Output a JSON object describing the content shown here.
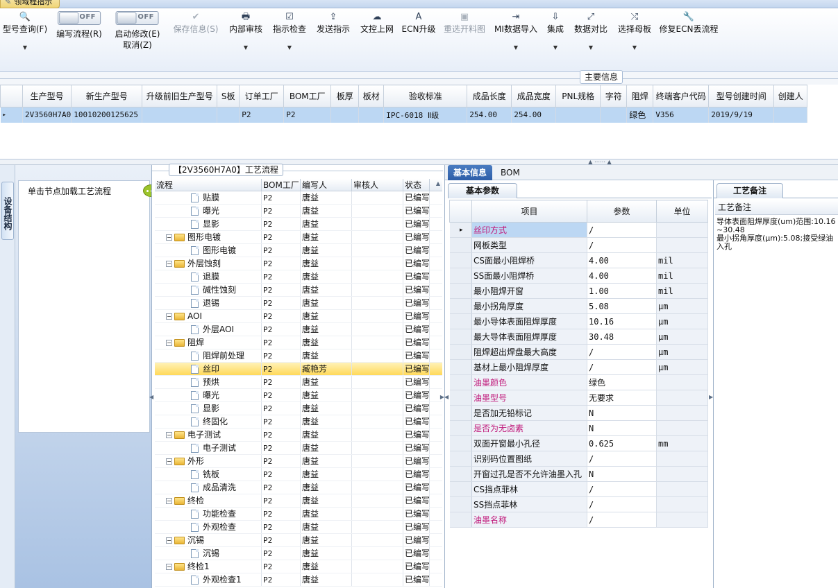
{
  "window": {
    "tab_label": "领域程指示"
  },
  "toolbar": [
    {
      "id": "model-query",
      "icon": "🔍",
      "label": "型号查询(F)",
      "dropdown": true,
      "disabled": false
    },
    {
      "id": "write-flow",
      "label": "编写流程(R)",
      "toggle": "OFF"
    },
    {
      "id": "start-modify",
      "label": "启动修改(E)",
      "label2": "取消(Z)",
      "toggle": "OFF"
    },
    {
      "id": "save-info",
      "icon": "✔",
      "label": "保存信息(S)",
      "disabled": true
    },
    {
      "id": "internal-review",
      "icon": "🖶",
      "label": "内部审核",
      "dropdown": true,
      "disabled": false
    },
    {
      "id": "instruction-check",
      "icon": "☑",
      "label": "指示检查",
      "dropdown": true,
      "disabled": false
    },
    {
      "id": "send-instruction",
      "icon": "⇪",
      "label": "发送指示",
      "disabled": false
    },
    {
      "id": "doc-upload",
      "icon": "☁",
      "label": "文控上网",
      "disabled": false
    },
    {
      "id": "ecn-upgrade",
      "icon": "A",
      "label": "ECN升级",
      "disabled": false
    },
    {
      "id": "reselect-cut",
      "icon": "▣",
      "label": "重选开料图",
      "disabled": true
    },
    {
      "id": "mi-import",
      "icon": "⇥",
      "label": "MI数据导入",
      "dropdown": true,
      "disabled": false
    },
    {
      "id": "integrate",
      "icon": "⇩",
      "label": "集成",
      "dropdown": true,
      "disabled": false
    },
    {
      "id": "data-compare",
      "icon": "⤢",
      "label": "数据对比",
      "dropdown": true,
      "disabled": false
    },
    {
      "id": "select-mother",
      "icon": "⤮",
      "label": "选择母板",
      "dropdown": true,
      "disabled": false
    },
    {
      "id": "fix-ecn",
      "icon": "🔧",
      "label": "修复ECN丢流程",
      "disabled": false
    }
  ],
  "main_info": {
    "caption": "主要信息",
    "columns": [
      "生产型号",
      "新生产型号",
      "升级前旧生产型号",
      "S板",
      "订单工厂",
      "BOM工厂",
      "板厚",
      "板材",
      "验收标准",
      "成品长度",
      "成品宽度",
      "PNL规格",
      "字符",
      "阻焊",
      "终端客户代码",
      "型号创建时间",
      "创建人"
    ],
    "rows": [
      [
        "2V3560H7A0",
        "10010200125625",
        "",
        "",
        "P2",
        "P2",
        "",
        "",
        "IPC-6018 Ⅱ级",
        "254.00",
        "254.00",
        "",
        "",
        "绿色",
        "V356",
        "2019/9/19",
        ""
      ]
    ]
  },
  "left_panel": {
    "vertical_tab": "设备结构",
    "header": "单击节点加载工艺流程"
  },
  "process": {
    "title": "【2V3560H7A0】工艺流程",
    "columns": [
      "流程",
      "BOM工厂",
      "编写人",
      "审核人",
      "状态"
    ],
    "rows": [
      {
        "name": "贴膜",
        "level": 2,
        "factory": "P2",
        "writer": "唐益",
        "reviewer": "",
        "status": "已编写"
      },
      {
        "name": "曝光",
        "level": 2,
        "factory": "P2",
        "writer": "唐益",
        "reviewer": "",
        "status": "已编写"
      },
      {
        "name": "显影",
        "level": 2,
        "factory": "P2",
        "writer": "唐益",
        "reviewer": "",
        "status": "已编写"
      },
      {
        "name": "图形电镀",
        "level": 1,
        "factory": "P2",
        "writer": "唐益",
        "reviewer": "",
        "status": "已编写"
      },
      {
        "name": "图形电镀",
        "level": 2,
        "factory": "P2",
        "writer": "唐益",
        "reviewer": "",
        "status": "已编写"
      },
      {
        "name": "外层蚀刻",
        "level": 1,
        "factory": "P2",
        "writer": "唐益",
        "reviewer": "",
        "status": "已编写"
      },
      {
        "name": "退膜",
        "level": 2,
        "factory": "P2",
        "writer": "唐益",
        "reviewer": "",
        "status": "已编写"
      },
      {
        "name": "碱性蚀刻",
        "level": 2,
        "factory": "P2",
        "writer": "唐益",
        "reviewer": "",
        "status": "已编写"
      },
      {
        "name": "退锡",
        "level": 2,
        "factory": "P2",
        "writer": "唐益",
        "reviewer": "",
        "status": "已编写"
      },
      {
        "name": "AOI",
        "level": 1,
        "factory": "P2",
        "writer": "唐益",
        "reviewer": "",
        "status": "已编写"
      },
      {
        "name": "外层AOI",
        "level": 2,
        "factory": "P2",
        "writer": "唐益",
        "reviewer": "",
        "status": "已编写"
      },
      {
        "name": "阻焊",
        "level": 1,
        "factory": "P2",
        "writer": "唐益",
        "reviewer": "",
        "status": "已编写"
      },
      {
        "name": "阻焊前处理",
        "level": 2,
        "factory": "P2",
        "writer": "唐益",
        "reviewer": "",
        "status": "已编写"
      },
      {
        "name": "丝印",
        "level": 2,
        "factory": "P2",
        "writer": "臧艳芳",
        "reviewer": "",
        "status": "已编写",
        "selected": true
      },
      {
        "name": "预烘",
        "level": 2,
        "factory": "P2",
        "writer": "唐益",
        "reviewer": "",
        "status": "已编写"
      },
      {
        "name": "曝光",
        "level": 2,
        "factory": "P2",
        "writer": "唐益",
        "reviewer": "",
        "status": "已编写"
      },
      {
        "name": "显影",
        "level": 2,
        "factory": "P2",
        "writer": "唐益",
        "reviewer": "",
        "status": "已编写"
      },
      {
        "name": "终固化",
        "level": 2,
        "factory": "P2",
        "writer": "唐益",
        "reviewer": "",
        "status": "已编写"
      },
      {
        "name": "电子测试",
        "level": 1,
        "factory": "P2",
        "writer": "唐益",
        "reviewer": "",
        "status": "已编写"
      },
      {
        "name": "电子测试",
        "level": 2,
        "factory": "P2",
        "writer": "唐益",
        "reviewer": "",
        "status": "已编写"
      },
      {
        "name": "外形",
        "level": 1,
        "factory": "P2",
        "writer": "唐益",
        "reviewer": "",
        "status": "已编写"
      },
      {
        "name": "铣板",
        "level": 2,
        "factory": "P2",
        "writer": "唐益",
        "reviewer": "",
        "status": "已编写"
      },
      {
        "name": "成品清洗",
        "level": 2,
        "factory": "P2",
        "writer": "唐益",
        "reviewer": "",
        "status": "已编写"
      },
      {
        "name": "终检",
        "level": 1,
        "factory": "P2",
        "writer": "唐益",
        "reviewer": "",
        "status": "已编写"
      },
      {
        "name": "功能检查",
        "level": 2,
        "factory": "P2",
        "writer": "唐益",
        "reviewer": "",
        "status": "已编写"
      },
      {
        "name": "外观检查",
        "level": 2,
        "factory": "P2",
        "writer": "唐益",
        "reviewer": "",
        "status": "已编写"
      },
      {
        "name": "沉锡",
        "level": 1,
        "factory": "P2",
        "writer": "唐益",
        "reviewer": "",
        "status": "已编写"
      },
      {
        "name": "沉锡",
        "level": 2,
        "factory": "P2",
        "writer": "唐益",
        "reviewer": "",
        "status": "已编写"
      },
      {
        "name": "终检1",
        "level": 1,
        "factory": "P2",
        "writer": "唐益",
        "reviewer": "",
        "status": "已编写"
      },
      {
        "name": "外观检查1",
        "level": 2,
        "factory": "P2",
        "writer": "唐益",
        "reviewer": "",
        "status": "已编写"
      }
    ]
  },
  "right": {
    "tabs": [
      "基本信息",
      "BOM"
    ],
    "active_tab": "基本信息",
    "basic_tab": "基本参数",
    "param_columns": [
      "项目",
      "参数",
      "单位"
    ],
    "params": [
      {
        "item": "丝印方式",
        "value": "/",
        "unit": "",
        "pink": true,
        "current": true
      },
      {
        "item": "网板类型",
        "value": "/",
        "unit": ""
      },
      {
        "item": "CS面最小阻焊桥",
        "value": "4.00",
        "unit": "mil"
      },
      {
        "item": "SS面最小阻焊桥",
        "value": "4.00",
        "unit": "mil"
      },
      {
        "item": "最小阻焊开窗",
        "value": "1.00",
        "unit": "mil"
      },
      {
        "item": "最小拐角厚度",
        "value": "5.08",
        "unit": "μm"
      },
      {
        "item": "最小导体表面阻焊厚度",
        "value": "10.16",
        "unit": "μm"
      },
      {
        "item": "最大导体表面阻焊厚度",
        "value": "30.48",
        "unit": "μm"
      },
      {
        "item": "阻焊超出焊盘最大高度",
        "value": "/",
        "unit": "μm"
      },
      {
        "item": "基材上最小阻焊厚度",
        "value": "/",
        "unit": "μm"
      },
      {
        "item": "油墨颜色",
        "value": "绿色",
        "unit": "",
        "pink": true
      },
      {
        "item": "油墨型号",
        "value": "无要求",
        "unit": "",
        "pink": true
      },
      {
        "item": "是否加无铅标记",
        "value": "N",
        "unit": ""
      },
      {
        "item": "是否为无卤素",
        "value": "N",
        "unit": "",
        "pink": true
      },
      {
        "item": "双面开窗最小孔径",
        "value": "0.625",
        "unit": "mm"
      },
      {
        "item": "识别码位置图纸",
        "value": "/",
        "unit": ""
      },
      {
        "item": "开窗过孔是否不允许油墨入孔",
        "value": "N",
        "unit": ""
      },
      {
        "item": "CS挡点菲林",
        "value": "/",
        "unit": ""
      },
      {
        "item": "SS挡点菲林",
        "value": "/",
        "unit": ""
      },
      {
        "item": "油墨名称",
        "value": "/",
        "unit": "",
        "pink": true
      }
    ],
    "remark_tab": "工艺备注",
    "remark_label": "工艺备注",
    "remark_text": "导体表面阻焊厚度(um)范围:10.16~30.48\n最小拐角厚度(μm):5.08;接受绿油入孔"
  }
}
